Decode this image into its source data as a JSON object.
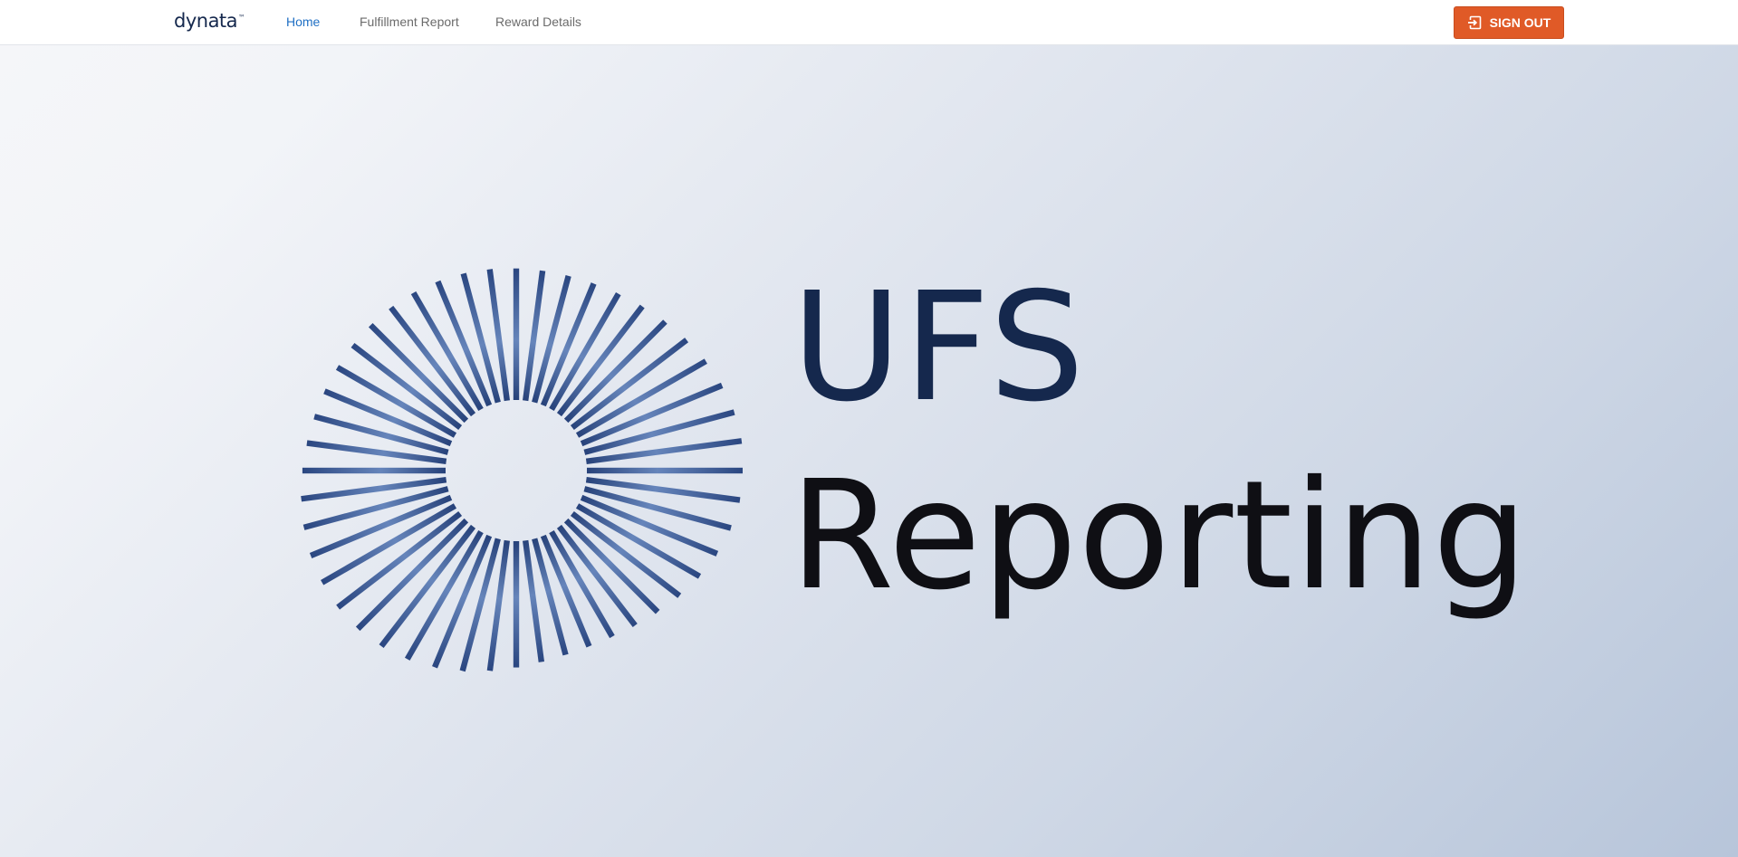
{
  "header": {
    "brand": "dynata",
    "brand_mark": "™",
    "nav": [
      {
        "label": "Home",
        "active": true
      },
      {
        "label": "Fulfillment Report",
        "active": false
      },
      {
        "label": "Reward Details",
        "active": false
      }
    ],
    "sign_out_label": "SIGN OUT",
    "sign_out_icon": "sign-out-icon"
  },
  "hero": {
    "title_line1": "UFS",
    "title_line2": "Reporting",
    "logo_icon": "radial-burst-logo"
  },
  "colors": {
    "accent": "#1f6fc4",
    "sign_out": "#e05a27",
    "brand_navy": "#15284d",
    "nav_text": "#6b6b6b"
  }
}
